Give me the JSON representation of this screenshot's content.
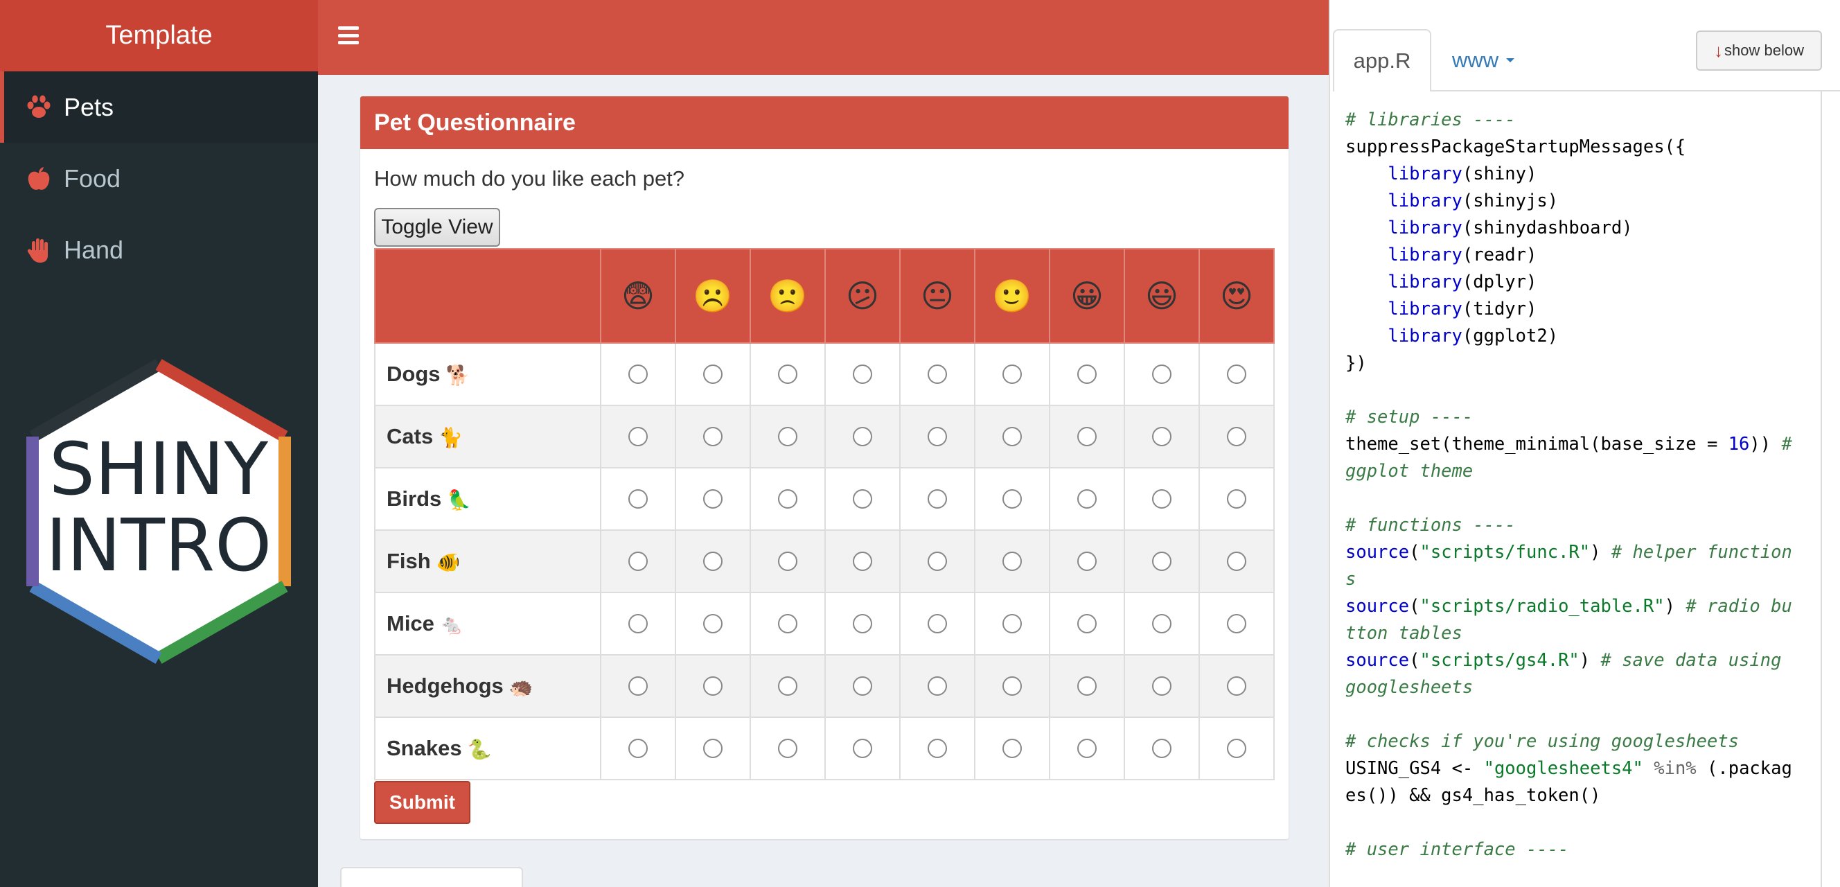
{
  "app": {
    "title": "Template",
    "sidebar": {
      "items": [
        {
          "label": "Pets",
          "icon": "paw-icon",
          "active": true
        },
        {
          "label": "Food",
          "icon": "apple-icon",
          "active": false
        },
        {
          "label": "Hand",
          "icon": "hand-icon",
          "active": false
        }
      ],
      "logo": {
        "line1": "SHINY",
        "line2": "INTRO"
      }
    },
    "box": {
      "title": "Pet Questionnaire",
      "question": "How much do you like each pet?",
      "toggle_label": "Toggle View",
      "scale_emojis": [
        "😨",
        "☹️",
        "🙁",
        "😕",
        "😐",
        "🙂",
        "😀",
        "😃",
        "😍"
      ],
      "rows": [
        {
          "label": "Dogs",
          "emoji": "🐕"
        },
        {
          "label": "Cats",
          "emoji": "🐈"
        },
        {
          "label": "Birds",
          "emoji": "🦜"
        },
        {
          "label": "Fish",
          "emoji": "🐠"
        },
        {
          "label": "Mice",
          "emoji": "🐁"
        },
        {
          "label": "Hedgehogs",
          "emoji": "🦔"
        },
        {
          "label": "Snakes",
          "emoji": "🐍"
        }
      ],
      "submit_label": "Submit"
    }
  },
  "code_panel": {
    "tabs": [
      {
        "label": "app.R",
        "active": true
      },
      {
        "label": "www",
        "active": false
      }
    ],
    "show_below_label": "show below",
    "code_lines": [
      [
        [
          "c-com",
          "# libraries ----"
        ]
      ],
      [
        [
          "c-pl",
          "suppressPackageStartupMessages({"
        ]
      ],
      [
        [
          "c-pl",
          "    "
        ],
        [
          "c-fn",
          "library"
        ],
        [
          "c-pl",
          "(shiny)"
        ]
      ],
      [
        [
          "c-pl",
          "    "
        ],
        [
          "c-fn",
          "library"
        ],
        [
          "c-pl",
          "(shinyjs)"
        ]
      ],
      [
        [
          "c-pl",
          "    "
        ],
        [
          "c-fn",
          "library"
        ],
        [
          "c-pl",
          "(shinydashboard)"
        ]
      ],
      [
        [
          "c-pl",
          "    "
        ],
        [
          "c-fn",
          "library"
        ],
        [
          "c-pl",
          "(readr)"
        ]
      ],
      [
        [
          "c-pl",
          "    "
        ],
        [
          "c-fn",
          "library"
        ],
        [
          "c-pl",
          "(dplyr)"
        ]
      ],
      [
        [
          "c-pl",
          "    "
        ],
        [
          "c-fn",
          "library"
        ],
        [
          "c-pl",
          "(tidyr)"
        ]
      ],
      [
        [
          "c-pl",
          "    "
        ],
        [
          "c-fn",
          "library"
        ],
        [
          "c-pl",
          "(ggplot2)"
        ]
      ],
      [
        [
          "c-pl",
          "})"
        ]
      ],
      [
        [
          "c-pl",
          ""
        ]
      ],
      [
        [
          "c-com",
          "# setup ----"
        ]
      ],
      [
        [
          "c-pl",
          "theme_set(theme_minimal(base_size = "
        ],
        [
          "c-num",
          "16"
        ],
        [
          "c-pl",
          ")) "
        ],
        [
          "c-com",
          "#"
        ]
      ],
      [
        [
          "c-com",
          "ggplot theme"
        ]
      ],
      [
        [
          "c-pl",
          ""
        ]
      ],
      [
        [
          "c-com",
          "# functions ----"
        ]
      ],
      [
        [
          "c-fn",
          "source"
        ],
        [
          "c-pl",
          "("
        ],
        [
          "c-str",
          "\"scripts/func.R\""
        ],
        [
          "c-pl",
          ") "
        ],
        [
          "c-com",
          "# helper function"
        ]
      ],
      [
        [
          "c-com",
          "s"
        ]
      ],
      [
        [
          "c-fn",
          "source"
        ],
        [
          "c-pl",
          "("
        ],
        [
          "c-str",
          "\"scripts/radio_table.R\""
        ],
        [
          "c-pl",
          ") "
        ],
        [
          "c-com",
          "# radio bu"
        ]
      ],
      [
        [
          "c-com",
          "tton tables"
        ]
      ],
      [
        [
          "c-fn",
          "source"
        ],
        [
          "c-pl",
          "("
        ],
        [
          "c-str",
          "\"scripts/gs4.R\""
        ],
        [
          "c-pl",
          ") "
        ],
        [
          "c-com",
          "# save data using"
        ]
      ],
      [
        [
          "c-com",
          "googlesheets"
        ]
      ],
      [
        [
          "c-pl",
          ""
        ]
      ],
      [
        [
          "c-com",
          "# checks if you're using googlesheets"
        ]
      ],
      [
        [
          "c-pl",
          "USING_GS4 <- "
        ],
        [
          "c-str",
          "\"googlesheets4\""
        ],
        [
          "c-op",
          " %in% "
        ],
        [
          "c-pl",
          "(.packag"
        ]
      ],
      [
        [
          "c-pl",
          "es()) && gs4_has_token()"
        ]
      ],
      [
        [
          "c-pl",
          ""
        ]
      ],
      [
        [
          "c-com",
          "# user interface ----"
        ]
      ]
    ]
  },
  "colors": {
    "brand_red": "#d05142",
    "logo_red": "#c94335",
    "sidebar_dark": "#222d32",
    "body_bg": "#ecf0f5"
  }
}
